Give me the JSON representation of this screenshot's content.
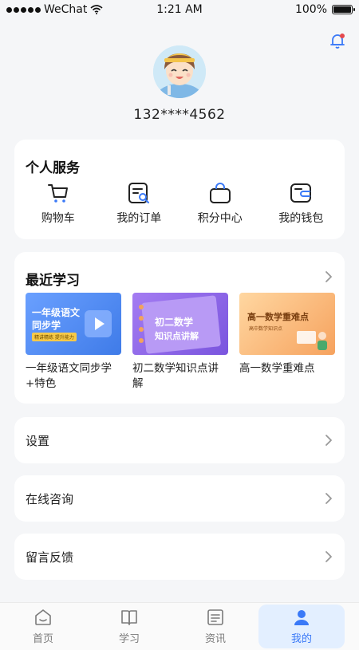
{
  "status_bar": {
    "carrier": "WeChat",
    "time": "1:21 AM",
    "battery": "100%"
  },
  "profile": {
    "phone": "132****4562"
  },
  "services": {
    "title": "个人服务",
    "items": [
      {
        "label": "购物车",
        "icon": "cart-icon"
      },
      {
        "label": "我的订单",
        "icon": "order-search-icon"
      },
      {
        "label": "积分中心",
        "icon": "bag-icon"
      },
      {
        "label": "我的钱包",
        "icon": "wallet-icon"
      }
    ]
  },
  "recent": {
    "title": "最近学习",
    "items": [
      {
        "title": "一年级语文同步学+特色",
        "thumb_line1": "一年级语文",
        "thumb_line2": "同步学",
        "thumb_sub": "精讲精练 提升能力",
        "thumb_color": "#5b8ff5"
      },
      {
        "title": "初二数学知识点讲解",
        "thumb_line1": "初二数学",
        "thumb_line2": "知识点讲解",
        "thumb_color": "#8f67e8"
      },
      {
        "title": "高一数学重难点",
        "thumb_line1": "高一数学重难点",
        "thumb_sub": "高中数学知识点",
        "thumb_color": "#f7b273"
      }
    ]
  },
  "menu": {
    "settings": "设置",
    "consult": "在线咨询",
    "feedback": "留言反馈"
  },
  "tabs": [
    {
      "label": "首页",
      "icon": "home-icon"
    },
    {
      "label": "学习",
      "icon": "book-icon"
    },
    {
      "label": "资讯",
      "icon": "news-icon"
    },
    {
      "label": "我的",
      "icon": "user-icon",
      "active": true
    }
  ],
  "colors": {
    "accent": "#3a79f7",
    "background": "#f5f6f8",
    "notification_dot": "#e5484d"
  }
}
